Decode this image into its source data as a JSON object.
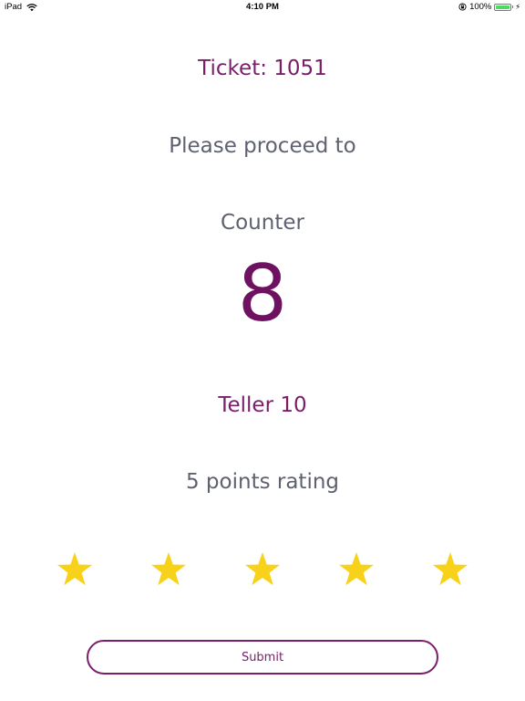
{
  "status_bar": {
    "device": "iPad",
    "time": "4:10 PM",
    "battery_percent": "100%",
    "battery_level": 1.0
  },
  "ticket": {
    "label": "Ticket: 1051"
  },
  "instruction": "Please proceed to",
  "counter": {
    "label": "Counter",
    "number": "8"
  },
  "teller": "Teller 10",
  "rating": {
    "label": "5 points rating",
    "max": 5,
    "value": 5,
    "star_color": "#f8d21a"
  },
  "submit_label": "Submit",
  "colors": {
    "accent": "#7b1d69",
    "text_secondary": "#5d6170",
    "battery_green": "#4cd964"
  }
}
